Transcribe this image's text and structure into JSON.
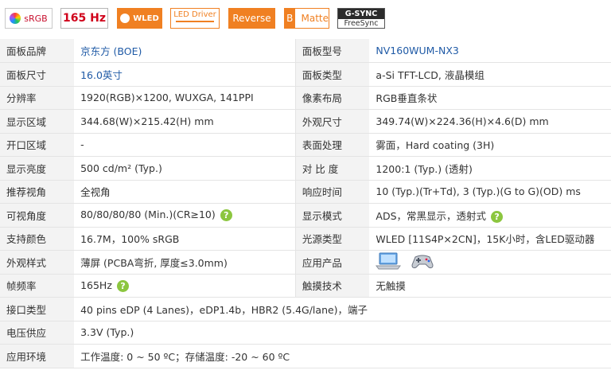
{
  "badges": {
    "srgb": "sRGB",
    "hz": "165 Hz",
    "wled": "WLED",
    "led_driver": "LED Driver",
    "reverse": "Reverse",
    "matte_letter": "B",
    "matte": "Matte",
    "gsync": "G-SYNC",
    "freesync": "FreeSync"
  },
  "rows": [
    {
      "l1": "面板品牌",
      "v1": "京东方 (BOE)",
      "l2": "面板型号",
      "v2": "NV160WUM-NX3"
    },
    {
      "l1": "面板尺寸",
      "v1": "16.0英寸",
      "l2": "面板类型",
      "v2": "a-Si TFT-LCD, 液晶模组"
    },
    {
      "l1": "分辨率",
      "v1": "1920(RGB)×1200, WUXGA, 141PPI",
      "l2": "像素布局",
      "v2": "RGB垂直条状"
    },
    {
      "l1": "显示区域",
      "v1": "344.68(W)×215.42(H) mm",
      "l2": "外观尺寸",
      "v2": "349.74(W)×224.36(H)×4.6(D) mm"
    },
    {
      "l1": "开口区域",
      "v1": "-",
      "l2": "表面处理",
      "v2": "雾面，Hard coating (3H)"
    },
    {
      "l1": "显示亮度",
      "v1": "500 cd/m² (Typ.)",
      "l2": "对 比 度",
      "v2": "1200:1 (Typ.) (透射)"
    },
    {
      "l1": "推荐视角",
      "v1": "全视角",
      "l2": "响应时间",
      "v2": "10 (Typ.)(Tr+Td), 3 (Typ.)(G to G)(OD) ms"
    },
    {
      "l1": "可视角度",
      "v1": "80/80/80/80 (Min.)(CR≥10)",
      "l2": "显示模式",
      "v2": "ADS，常黑显示，透射式"
    },
    {
      "l1": "支持颜色",
      "v1": "16.7M，100% sRGB",
      "l2": "光源类型",
      "v2": "WLED  [11S4P×2CN]，15K小时，含LED驱动器"
    },
    {
      "l1": "外观样式",
      "v1": "薄屏 (PCBA弯折, 厚度≤3.0mm)",
      "l2": "应用产品",
      "v2": ""
    },
    {
      "l1": "帧频率",
      "v1": "165Hz",
      "l2": "触摸技术",
      "v2": "无触摸"
    }
  ],
  "full_rows": [
    {
      "l": "接口类型",
      "v": "40 pins   eDP (4 Lanes)，eDP1.4b，HBR2 (5.4G/lane)，端子"
    },
    {
      "l": "电压供应",
      "v": "3.3V (Typ.)"
    },
    {
      "l": "应用环境",
      "v": "工作温度: 0 ~ 50 ºC；存储温度: -20 ~ 60 ºC"
    }
  ],
  "help_glyph": "?",
  "icons": [
    "laptop-icon",
    "gamepad-icon",
    "help-icon"
  ]
}
